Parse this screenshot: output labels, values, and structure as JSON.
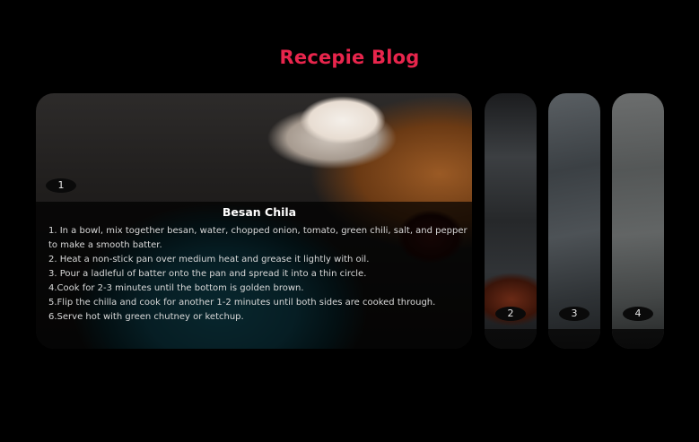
{
  "header": {
    "title": "Recepie Blog"
  },
  "colors": {
    "title": "#e8254c",
    "background": "#000000"
  },
  "slides": [
    {
      "number": "1",
      "title": "Besan Chila",
      "steps": [
        "1. In a bowl, mix together besan, water, chopped onion, tomato, green chili, salt, and pepper to make a smooth batter.",
        "2. Heat a non-stick pan over medium heat and grease it lightly with oil.",
        "3. Pour a ladleful of batter onto the pan and spread it into a thin circle.",
        "4.Cook for 2-3 minutes until the bottom is golden brown.",
        "5.Flip the chilla and cook for another 1-2 minutes until both sides are cooked through.",
        "6.Serve hot with green chutney or ketchup."
      ]
    },
    {
      "number": "2"
    },
    {
      "number": "3"
    },
    {
      "number": "4"
    }
  ]
}
